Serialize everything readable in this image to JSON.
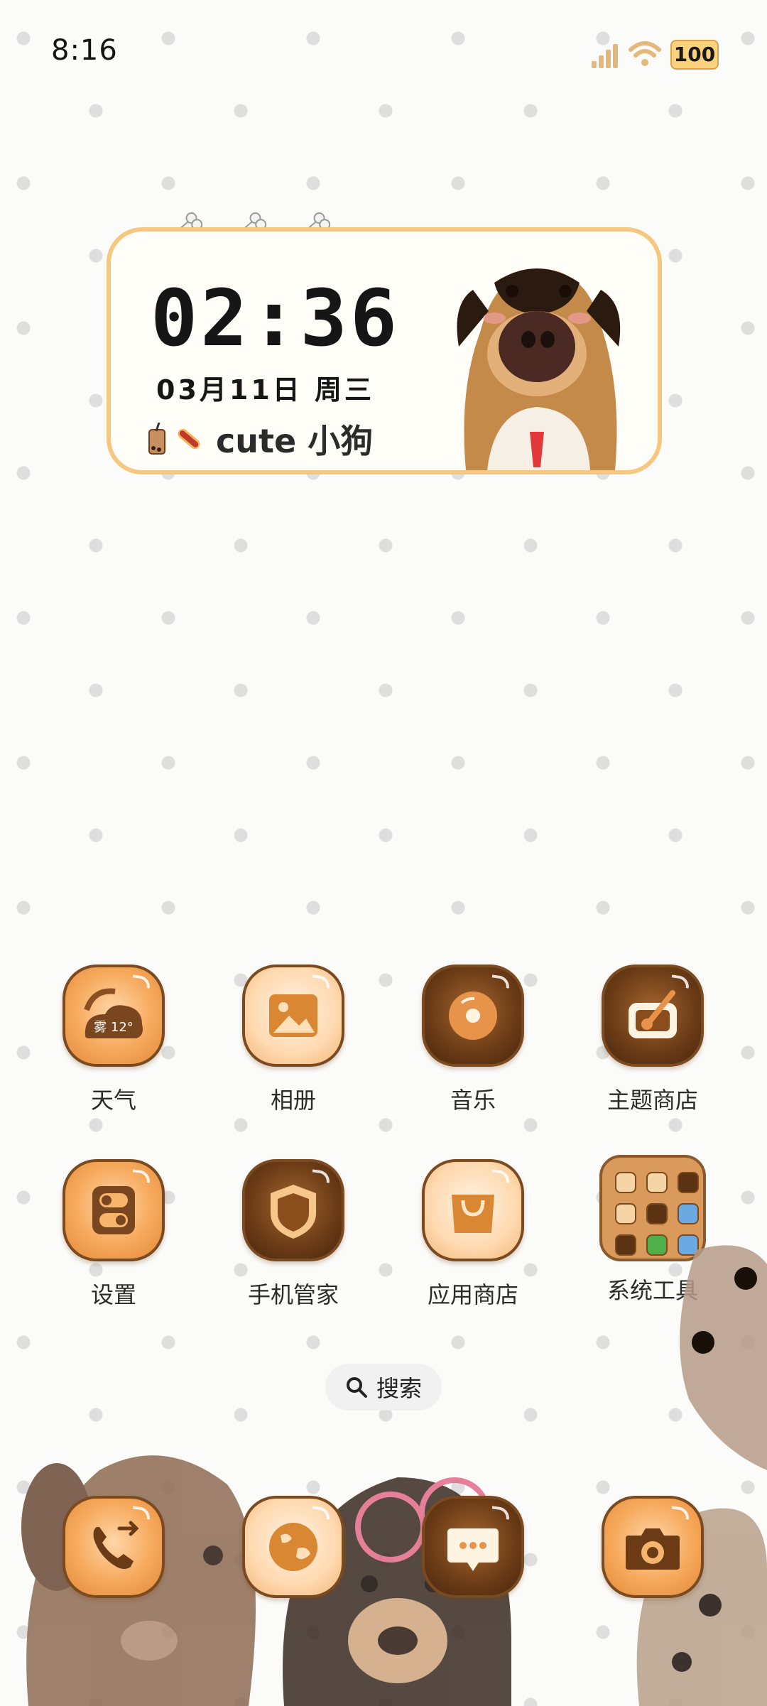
{
  "status_bar": {
    "time": "8:16",
    "battery": "100"
  },
  "widget": {
    "clock": "02:36",
    "date": "03月11日 周三",
    "tag": "cute 小狗"
  },
  "apps": [
    {
      "label": "天气",
      "weather_text": "雾 12°"
    },
    {
      "label": "相册"
    },
    {
      "label": "音乐"
    },
    {
      "label": "主题商店"
    },
    {
      "label": "设置"
    },
    {
      "label": "手机管家"
    },
    {
      "label": "应用商店"
    },
    {
      "label": "系统工具"
    }
  ],
  "search": {
    "label": "搜索"
  },
  "dock": [
    {
      "icon": "phone-icon"
    },
    {
      "icon": "browser-icon"
    },
    {
      "icon": "messages-icon"
    },
    {
      "icon": "camera-icon"
    }
  ],
  "colors": {
    "accent": "#f6a95c",
    "dark": "#6b3b16",
    "border": "#7a4a20"
  }
}
